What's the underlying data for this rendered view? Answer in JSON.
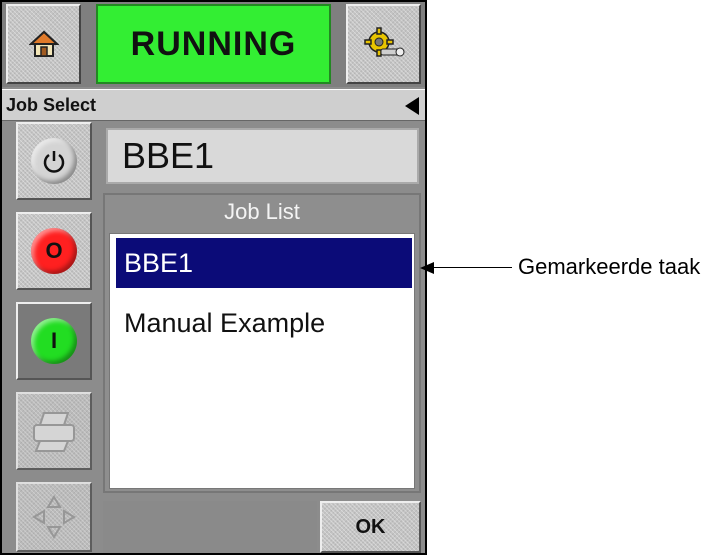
{
  "header": {
    "status": "RUNNING",
    "status_color": "#33ee33",
    "home_icon": "home-icon",
    "settings_icon": "settings-gear-icon"
  },
  "title_bar": {
    "title": "Job Select",
    "back_icon": "back-arrow-icon"
  },
  "sidebar": {
    "buttons": [
      {
        "name": "power-button",
        "icon": "power-icon"
      },
      {
        "name": "stop-button",
        "label": "O",
        "color": "#ff2020"
      },
      {
        "name": "start-button",
        "label": "I",
        "color": "#22dd22"
      },
      {
        "name": "print-button",
        "icon": "printer-icon"
      },
      {
        "name": "navigate-button",
        "icon": "direction-arrows-icon"
      }
    ]
  },
  "current_job": "BBE1",
  "job_list": {
    "title": "Job List",
    "items": [
      {
        "label": "BBE1",
        "selected": true
      },
      {
        "label": "Manual Example",
        "selected": false
      }
    ]
  },
  "ok_label": "OK",
  "annotation": {
    "text": "Gemarkeerde taak"
  }
}
